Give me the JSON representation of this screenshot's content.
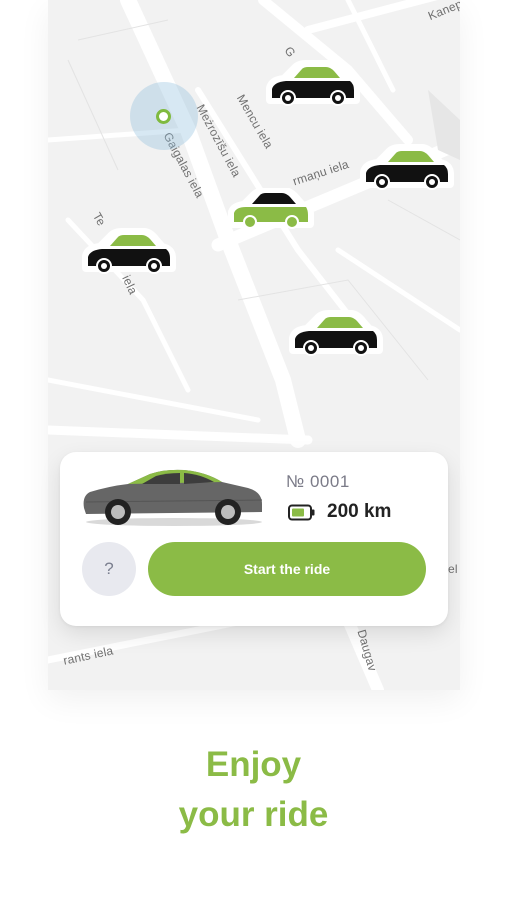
{
  "map": {
    "streets": {
      "kanep": "Kaneр",
      "g": "G",
      "mencu": "Mencu iela",
      "mezrozisu": "Meżrozīšu iela",
      "gaigalas": "Gaigalas iela",
      "rmanu": "rmaņu iela",
      "te": "Te",
      "iela_left": "iela",
      "rants": "rants iela",
      "el": "el",
      "daugav": "Daugav"
    }
  },
  "vehicle_card": {
    "car_number": "№ 0001",
    "range": "200 km",
    "help_label": "?",
    "start_label": "Start the ride"
  },
  "tagline": {
    "line1": "Enjoy",
    "line2": "your ride"
  },
  "colors": {
    "accent_green": "#8bbb46",
    "car_black": "#111111",
    "map_background": "#f2f2f2",
    "road": "#ffffff"
  }
}
